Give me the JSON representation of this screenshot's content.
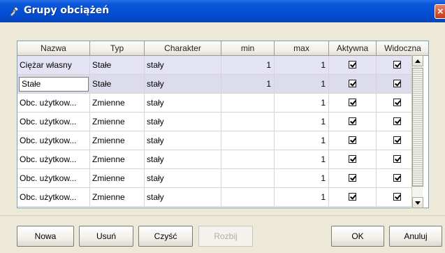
{
  "window": {
    "title": "Grupy obciążeń"
  },
  "table": {
    "columns": [
      "Nazwa",
      "Typ",
      "Charakter",
      "min",
      "max",
      "Aktywna",
      "Widoczna"
    ],
    "rows": [
      {
        "nazwa": "Ciężar własny",
        "typ": "Stałe",
        "charakter": "stały",
        "min": "1",
        "max": "1",
        "aktywna": true,
        "widoczna": true
      },
      {
        "nazwa": "Stałe",
        "typ": "Stałe",
        "charakter": "stały",
        "min": "1",
        "max": "1",
        "aktywna": true,
        "widoczna": true
      },
      {
        "nazwa": "Obc. użytkow...",
        "typ": "Zmienne",
        "charakter": "stały",
        "min": "",
        "max": "1",
        "aktywna": true,
        "widoczna": true
      },
      {
        "nazwa": "Obc. użytkow...",
        "typ": "Zmienne",
        "charakter": "stały",
        "min": "",
        "max": "1",
        "aktywna": true,
        "widoczna": true
      },
      {
        "nazwa": "Obc. użytkow...",
        "typ": "Zmienne",
        "charakter": "stały",
        "min": "",
        "max": "1",
        "aktywna": true,
        "widoczna": true
      },
      {
        "nazwa": "Obc. użytkow...",
        "typ": "Zmienne",
        "charakter": "stały",
        "min": "",
        "max": "1",
        "aktywna": true,
        "widoczna": true
      },
      {
        "nazwa": "Obc. użytkow...",
        "typ": "Zmienne",
        "charakter": "stały",
        "min": "",
        "max": "1",
        "aktywna": true,
        "widoczna": true
      },
      {
        "nazwa": "Obc. użytkow...",
        "typ": "Zmienne",
        "charakter": "stały",
        "min": "",
        "max": "1",
        "aktywna": true,
        "widoczna": true
      }
    ]
  },
  "buttons": {
    "nowa": "Nowa",
    "usun": "Usuń",
    "czysc": "Czyść",
    "rozbij": "Rozbij",
    "ok": "OK",
    "anuluj": "Anuluj"
  },
  "colors": {
    "titlebar": "#0550d6",
    "selected_row": "#e3e3f4",
    "close_button": "#d54f27"
  },
  "icons": {
    "title": "pin-tool-icon",
    "close": "close-icon",
    "scroll_up": "arrow-up-icon",
    "scroll_down": "arrow-down-icon"
  }
}
